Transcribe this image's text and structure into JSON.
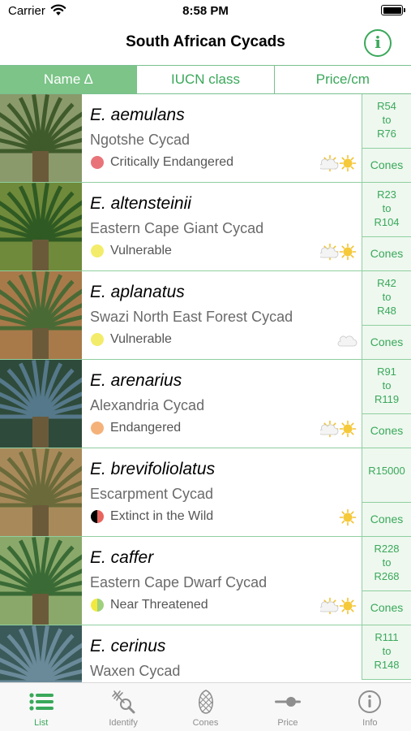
{
  "status_bar": {
    "carrier": "Carrier",
    "time": "8:58 PM"
  },
  "nav": {
    "title": "South African Cycads",
    "info_label": "i"
  },
  "sort": {
    "tabs": [
      {
        "label": "Name ∆",
        "active": true
      },
      {
        "label": "IUCN class",
        "active": false
      },
      {
        "label": "Price/cm",
        "active": false
      }
    ]
  },
  "colors": {
    "accent": "#3aa85a",
    "critically_endangered": "#e8747a",
    "vulnerable": "#f3ec6a",
    "endangered": "#f4b27a"
  },
  "species": [
    {
      "name": "E. aemulans",
      "common": "Ngotshe Cycad",
      "status": "Critically Endangered",
      "dot": "#e8747a",
      "dot_style": "solid",
      "weather": [
        "partly-sunny-icon",
        "sun-icon"
      ],
      "price": "R54\nto\nR76",
      "cones": "Cones",
      "photo": [
        "#3f5a2b",
        "#8a9a6a"
      ]
    },
    {
      "name": "E. altensteinii",
      "common": "Eastern Cape Giant Cycad",
      "status": "Vulnerable",
      "dot": "#f3ec6a",
      "dot_style": "solid",
      "weather": [
        "partly-sunny-icon",
        "sun-icon"
      ],
      "price": "R23\nto\nR104",
      "cones": "Cones",
      "photo": [
        "#2f5a23",
        "#6f8a3a"
      ]
    },
    {
      "name": "E. aplanatus",
      "common": "Swazi North East Forest Cycad",
      "status": "Vulnerable",
      "dot": "#f3ec6a",
      "dot_style": "solid",
      "weather": [
        "cloud-icon"
      ],
      "price": "R42\nto\nR48",
      "cones": "Cones",
      "photo": [
        "#4a6a35",
        "#a87a4a"
      ]
    },
    {
      "name": "E. arenarius",
      "common": "Alexandria Cycad",
      "status": "Endangered",
      "dot": "#f4b27a",
      "dot_style": "solid",
      "weather": [
        "partly-sunny-icon",
        "sun-icon"
      ],
      "price": "R91\nto\nR119",
      "cones": "Cones",
      "photo": [
        "#55788a",
        "#2e4a3a"
      ]
    },
    {
      "name": "E. brevifoliolatus",
      "common": "Escarpment Cycad",
      "status": "Extinct in the Wild",
      "dot": "#000000",
      "dot_style": "half",
      "weather": [
        "sun-icon"
      ],
      "price": "R15000",
      "cones": "Cones",
      "photo": [
        "#6a6a3a",
        "#a88a5a"
      ]
    },
    {
      "name": "E. caffer",
      "common": "Eastern Cape Dwarf Cycad",
      "status": "Near Threatened",
      "dot": "#f2e940",
      "dot_style": "half-nt",
      "weather": [
        "partly-sunny-icon",
        "sun-icon"
      ],
      "price": "R228\nto\nR268",
      "cones": "Cones",
      "photo": [
        "#3a6a35",
        "#8aa86a"
      ]
    },
    {
      "name": "E. cerinus",
      "common": "Waxen Cycad",
      "status": "",
      "dot": "",
      "dot_style": "none",
      "weather": [],
      "price": "R111\nto\nR148",
      "cones": "",
      "photo": [
        "#6a8a9a",
        "#3a5a5a"
      ]
    }
  ],
  "tabbar": {
    "items": [
      {
        "label": "List",
        "icon": "list-icon",
        "active": true
      },
      {
        "label": "Identify",
        "icon": "identify-icon",
        "active": false
      },
      {
        "label": "Cones",
        "icon": "cone-icon",
        "active": false
      },
      {
        "label": "Price",
        "icon": "price-slider-icon",
        "active": false
      },
      {
        "label": "Info",
        "icon": "info-icon",
        "active": false
      }
    ]
  }
}
